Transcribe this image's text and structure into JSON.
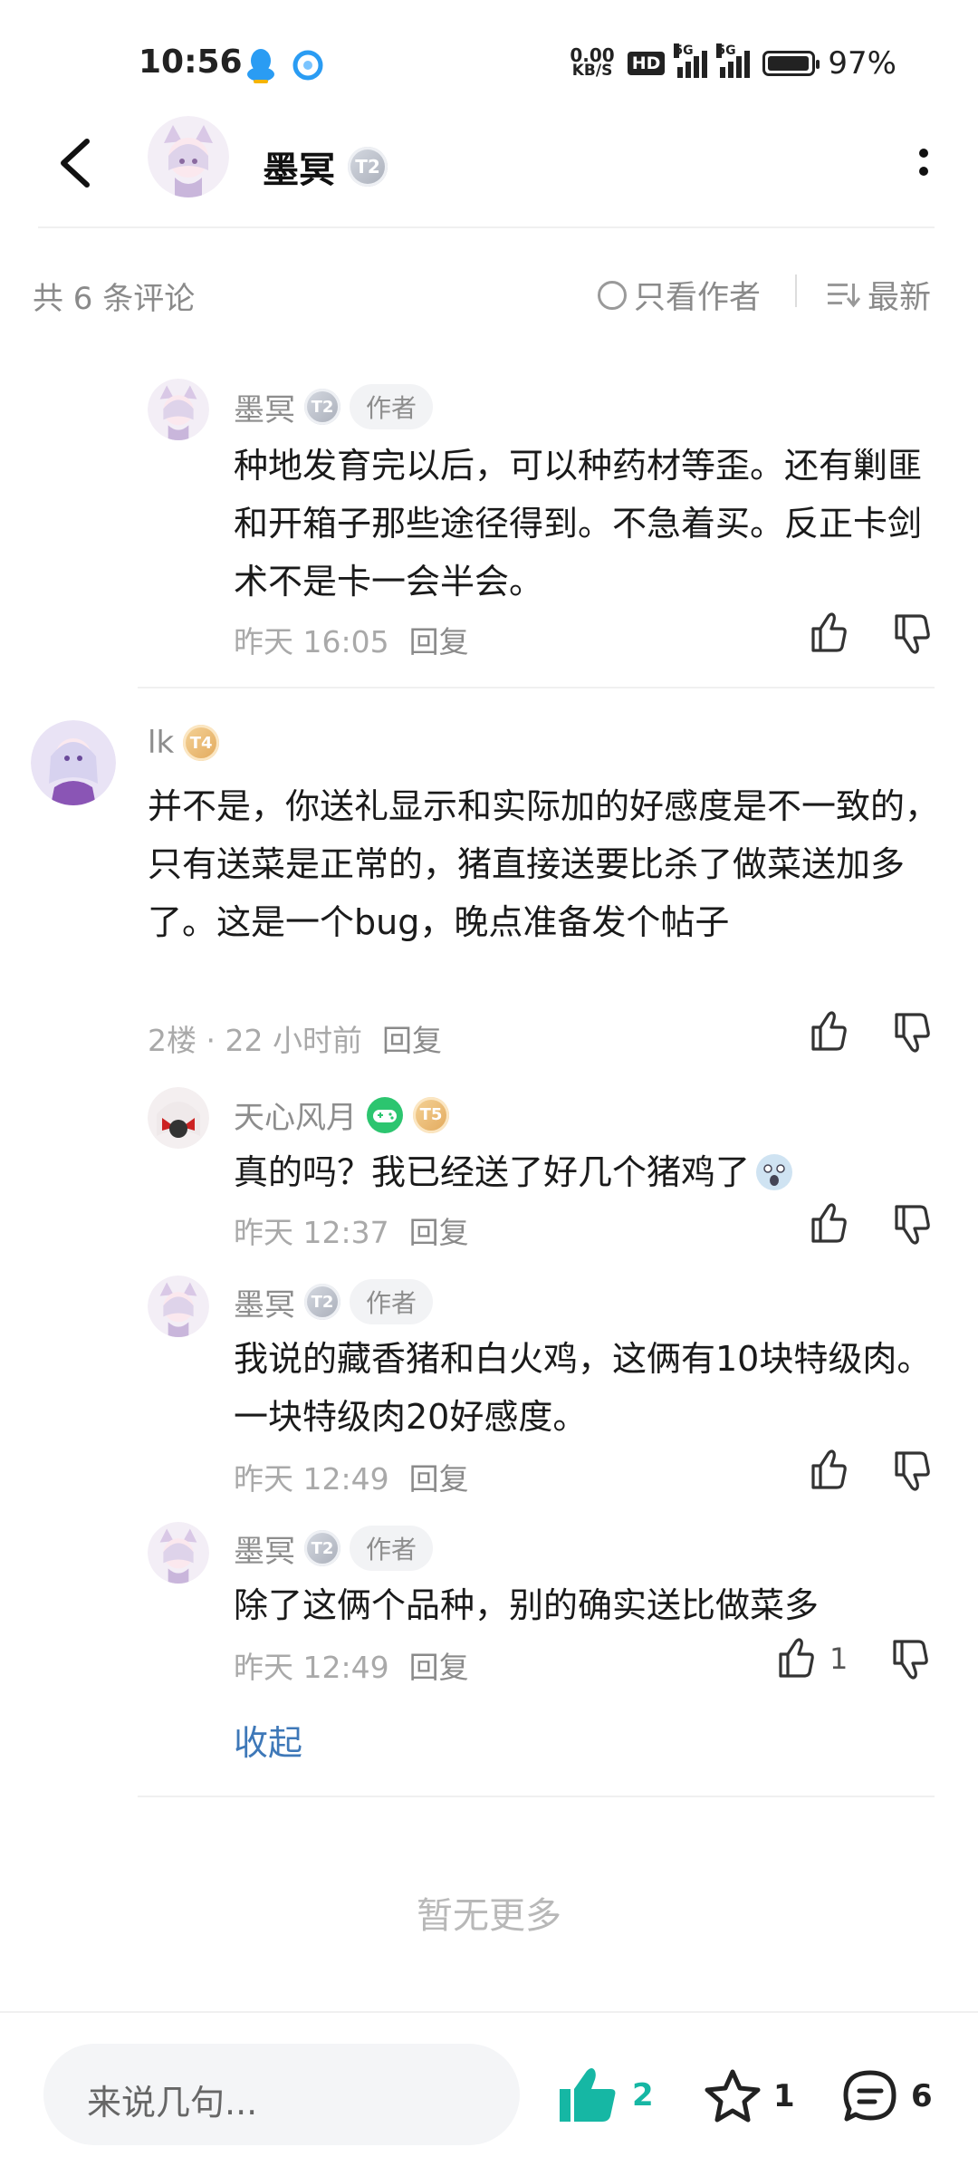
{
  "status_bar": {
    "time": "10:56",
    "net_speed_top": "0.00",
    "net_speed_bottom": "KB/S",
    "hd": "HD",
    "signal_1": "5G",
    "signal_2": "5G",
    "battery": "97%",
    "battery_level": 0.97
  },
  "header": {
    "title": "墨冥",
    "level_badge": "T2"
  },
  "toolbar": {
    "count": "共 6 条评论",
    "only_author": "只看作者",
    "sort": "最新"
  },
  "comments": [
    {
      "user": "墨冥",
      "level": "T2",
      "author_tag": "作者",
      "content": "种地发育完以后，可以种药材等歪。还有剿匪和开箱子那些途径得到。不急着买。反正卡剑术不是卡一会半会。",
      "time": "昨天 16:05",
      "reply": "回复"
    },
    {
      "user": "lk",
      "level": "T4",
      "content": "并不是，你送礼显示和实际加的好感度是不一致的，只有送菜是正常的，猪直接送要比杀了做菜送加多了。这是一个bug，晚点准备发个帖子",
      "time": "2楼 · 22 小时前",
      "reply": "回复"
    },
    {
      "user": "天心风月",
      "level": "T5",
      "content": "真的吗？我已经送了好几个猪鸡了",
      "time": "昨天 12:37",
      "reply": "回复"
    },
    {
      "user": "墨冥",
      "level": "T2",
      "author_tag": "作者",
      "content": "我说的藏香猪和白火鸡，这俩有10块特级肉。一块特级肉20好感度。",
      "time": "昨天 12:49",
      "reply": "回复"
    },
    {
      "user": "墨冥",
      "level": "T2",
      "author_tag": "作者",
      "content": "除了这俩个品种，别的确实送比做菜多",
      "time": "昨天 12:49",
      "reply": "回复",
      "likes": "1"
    }
  ],
  "collapse": "收起",
  "no_more": "暂无更多",
  "bottom_bar": {
    "input_placeholder": "来说几句...",
    "likes": "2",
    "favorites": "1",
    "comments": "6",
    "like_color": "#16b7a4"
  }
}
